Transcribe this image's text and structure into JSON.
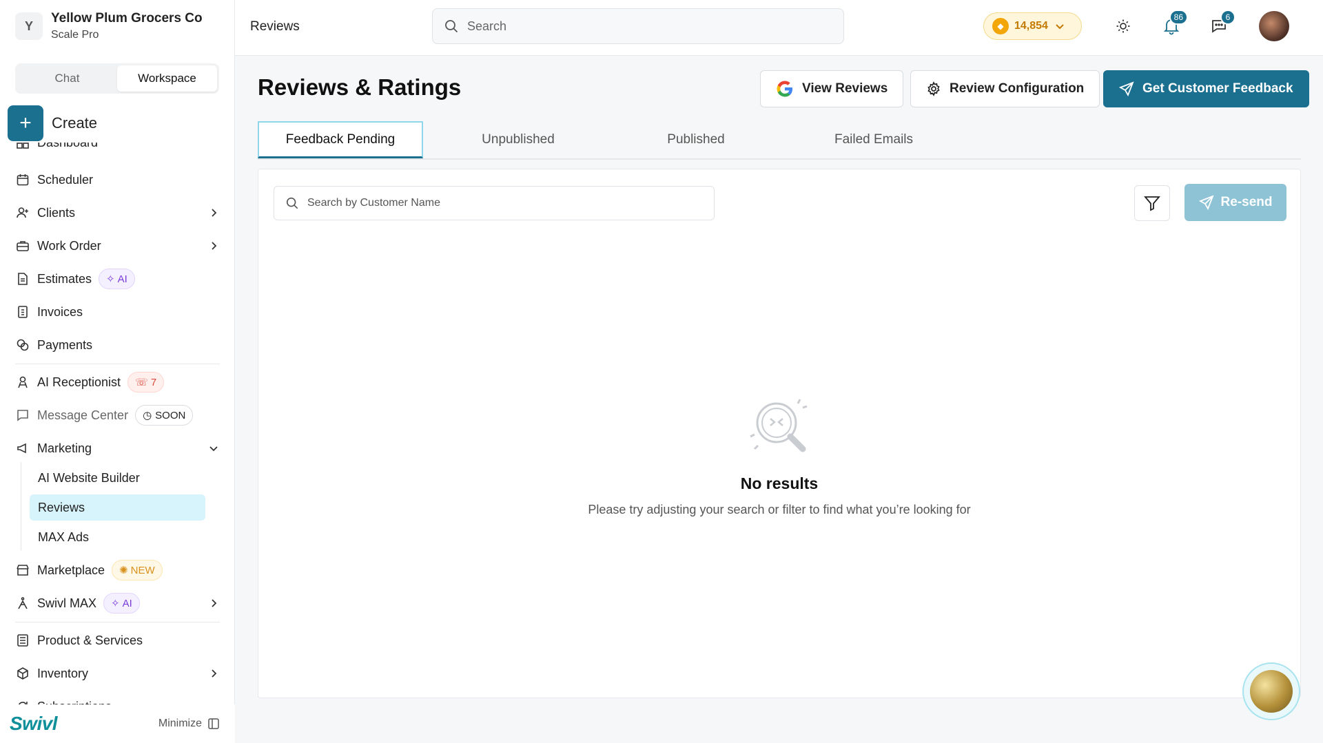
{
  "org": {
    "initial": "Y",
    "name": "Yellow Plum Grocers Co",
    "plan": "Scale Pro"
  },
  "mode_toggle": {
    "chat": "Chat",
    "workspace": "Workspace",
    "active": "Workspace"
  },
  "create_label": "Create",
  "sidebar": {
    "items": [
      {
        "label": "Dashboard"
      },
      {
        "label": "Scheduler"
      },
      {
        "label": "Clients"
      },
      {
        "label": "Work Order"
      },
      {
        "label": "Estimates",
        "badge": "AI"
      },
      {
        "label": "Invoices"
      },
      {
        "label": "Payments"
      },
      {
        "label": "AI Receptionist",
        "badge": "7"
      },
      {
        "label": "Message Center",
        "badge": "SOON"
      },
      {
        "label": "Marketing"
      },
      {
        "label": "Marketplace",
        "badge": "NEW"
      },
      {
        "label": "Swivl MAX",
        "badge": "AI"
      },
      {
        "label": "Product & Services"
      },
      {
        "label": "Inventory"
      },
      {
        "label": "Subscriptions"
      }
    ],
    "marketing_sub": [
      "AI Website Builder",
      "Reviews",
      "MAX Ads"
    ],
    "active_sub": "Reviews"
  },
  "footer": {
    "logo": "Swivl",
    "minimize": "Minimize"
  },
  "topbar": {
    "breadcrumb": "Reviews",
    "search_placeholder": "Search",
    "coins": "14,854",
    "notifications_count": "86",
    "messages_count": "6"
  },
  "page": {
    "title": "Reviews & Ratings",
    "view_reviews": "View Reviews",
    "review_configuration": "Review Configuration",
    "get_feedback": "Get Customer Feedback"
  },
  "tabs": [
    "Feedback Pending",
    "Unpublished",
    "Published",
    "Failed Emails"
  ],
  "active_tab": "Feedback Pending",
  "panel": {
    "search_placeholder": "Search by Customer Name",
    "resend": "Re-send",
    "empty_title": "No results",
    "empty_subtitle": "Please try adjusting your search or filter to find what you’re looking for"
  },
  "colors": {
    "primary": "#1b6f8f",
    "active_sub_bg": "#d7f3fb",
    "coins_text": "#c47a00"
  }
}
